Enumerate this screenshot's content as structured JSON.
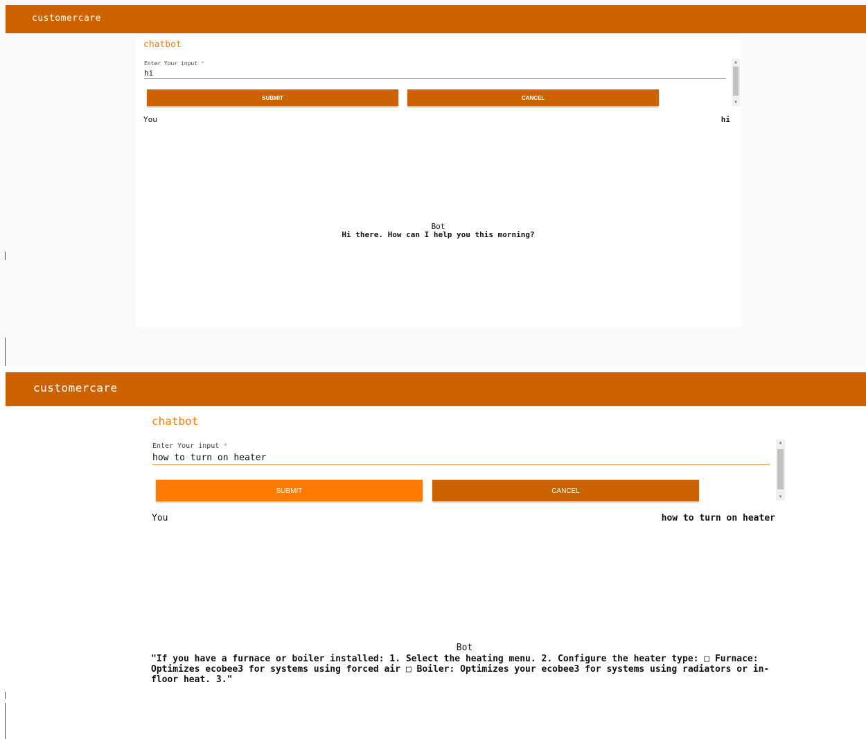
{
  "screens": [
    {
      "appbar": {
        "title": "customercare"
      },
      "card": {
        "heading": "chatbot",
        "field_label": "Enter Your input",
        "field_required_mark": "*",
        "input_value": "hi",
        "submit_label": "SUBMIT",
        "cancel_label": "CANCEL",
        "you_label": "You",
        "user_message": "hi",
        "bot_label": "Bot",
        "bot_message": "Hi there. How can I help you this morning?"
      }
    },
    {
      "appbar": {
        "title": "customercare"
      },
      "card": {
        "heading": "chatbot",
        "field_label": "Enter Your input",
        "field_required_mark": "*",
        "input_value": "how to turn on heater",
        "submit_label": "SUBMIT",
        "cancel_label": "CANCEL",
        "you_label": "You",
        "user_message": "how to turn on heater",
        "bot_label": "Bot",
        "bot_message": "\"If you have a furnace or boiler installed: 1. Select the heating menu. 2. Configure the heater type: □ Furnace: Optimizes ecobee3 for systems using forced air □ Boiler: Optimizes your ecobee3 for systems using radiators or in-floor heat. 3.\""
      }
    }
  ],
  "colors": {
    "appbar": "#cc6300",
    "accent": "#ff7a00",
    "page_background": "#fafafa",
    "card_background": "#ffffff"
  }
}
